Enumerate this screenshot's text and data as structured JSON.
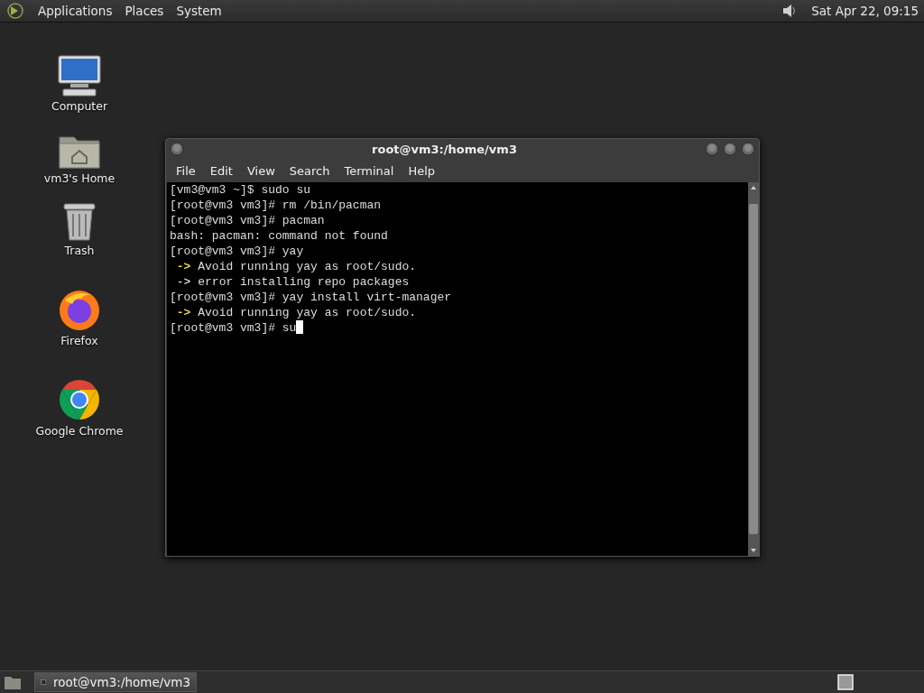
{
  "top_panel": {
    "menus": [
      "Applications",
      "Places",
      "System"
    ],
    "clock": "Sat Apr 22, 09:15"
  },
  "desktop_icons": [
    {
      "kind": "computer",
      "label": "Computer"
    },
    {
      "kind": "folder",
      "label": "vm3's Home"
    },
    {
      "kind": "trash",
      "label": "Trash"
    },
    {
      "kind": "firefox",
      "label": "Firefox"
    },
    {
      "kind": "chrome",
      "label": "Google Chrome"
    }
  ],
  "terminal_window": {
    "title": "root@vm3:/home/vm3",
    "menus": [
      "File",
      "Edit",
      "View",
      "Search",
      "Terminal",
      "Help"
    ],
    "lines": [
      {
        "kind": "plain",
        "text": "[vm3@vm3 ~]$ sudo su"
      },
      {
        "kind": "plain",
        "text": "[root@vm3 vm3]# rm /bin/pacman"
      },
      {
        "kind": "plain",
        "text": "[root@vm3 vm3]# pacman"
      },
      {
        "kind": "plain",
        "text": "bash: pacman: command not found"
      },
      {
        "kind": "plain",
        "text": "[root@vm3 vm3]# yay"
      },
      {
        "kind": "warning",
        "marker": "->",
        "text": "Avoid running yay as root/sudo."
      },
      {
        "kind": "error",
        "marker": "->",
        "text": "error installing repo packages"
      },
      {
        "kind": "plain",
        "text": "[root@vm3 vm3]# yay install virt-manager"
      },
      {
        "kind": "warning",
        "marker": "->",
        "text": "Avoid running yay as root/sudo."
      },
      {
        "kind": "input",
        "text": "[root@vm3 vm3]# su"
      }
    ]
  },
  "taskbar": {
    "tasks": [
      {
        "label": "root@vm3:/home/vm3",
        "selected": true
      }
    ]
  }
}
